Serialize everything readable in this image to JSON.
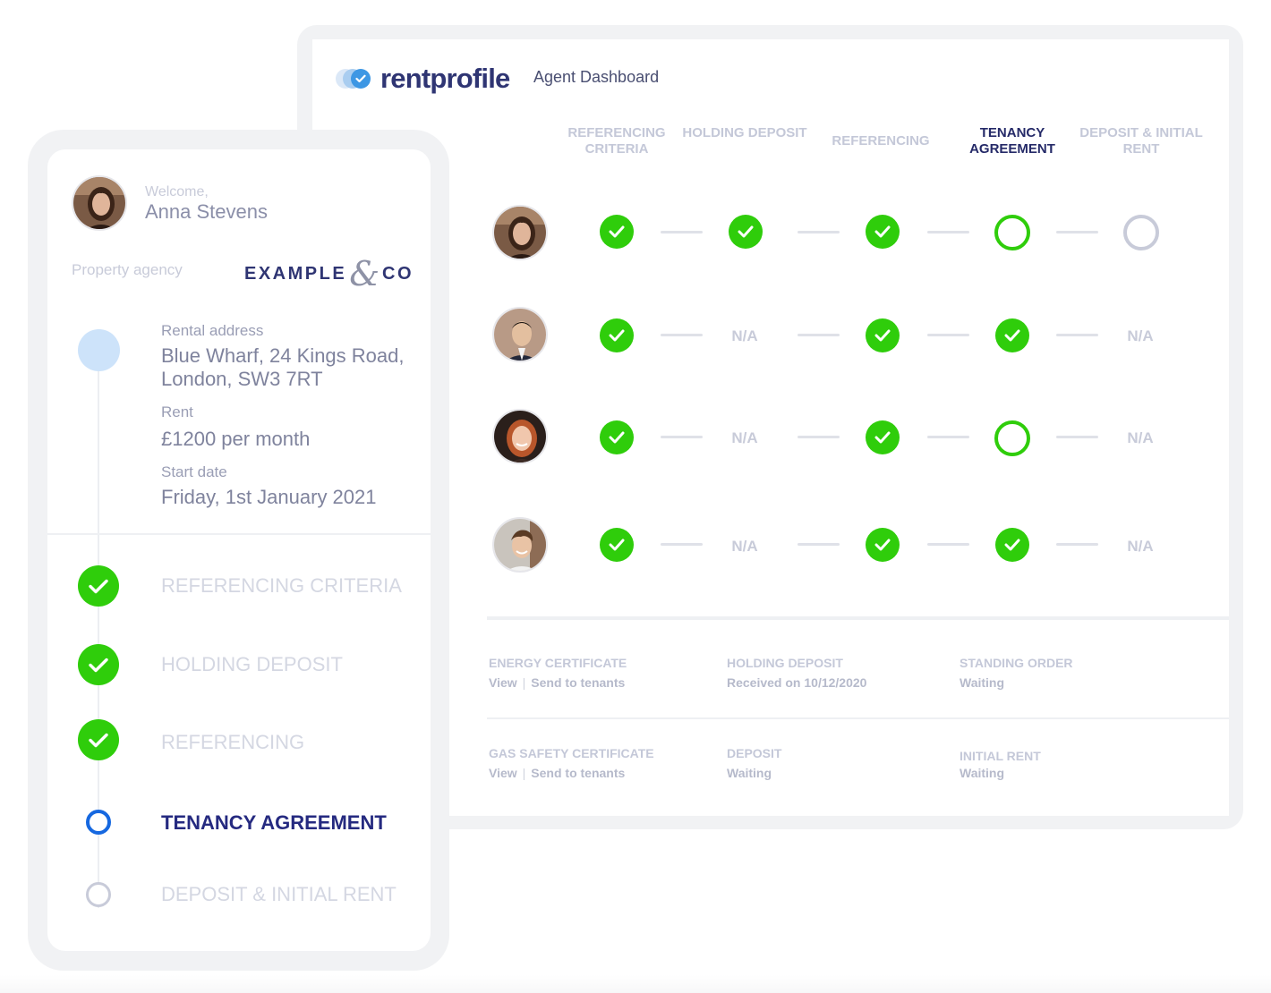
{
  "brand": {
    "name": "rentprofile",
    "subtitle": "Agent Dashboard"
  },
  "columns": [
    "REFERENCING CRITERIA",
    "HOLDING DEPOSIT",
    "REFERENCING",
    "TENANCY AGREEMENT",
    "DEPOSIT & INITIAL RENT"
  ],
  "active_column": "TENANCY AGREEMENT",
  "rows": [
    {
      "tenant": "tenant-1",
      "steps": [
        "done",
        "done",
        "done",
        "in-progress",
        "pending"
      ]
    },
    {
      "tenant": "tenant-2",
      "steps": [
        "done",
        "N/A",
        "done",
        "done",
        "N/A"
      ]
    },
    {
      "tenant": "tenant-3",
      "steps": [
        "done",
        "N/A",
        "done",
        "in-progress",
        "N/A"
      ]
    },
    {
      "tenant": "tenant-4",
      "steps": [
        "done",
        "N/A",
        "done",
        "done",
        "N/A"
      ]
    }
  ],
  "na_label": "N/A",
  "documents": {
    "energy_certificate": {
      "label": "ENERGY CERTIFICATE",
      "view": "View",
      "send": "Send to tenants"
    },
    "holding_deposit": {
      "label": "HOLDING DEPOSIT",
      "value": "Received on 10/12/2020"
    },
    "standing_order": {
      "label": "STANDING ORDER",
      "value": "Waiting"
    },
    "gas_safety_certificate": {
      "label": "GAS SAFETY CERTIFICATE",
      "view": "View",
      "send": "Send to tenants"
    },
    "deposit": {
      "label": "DEPOSIT",
      "value": "Waiting"
    },
    "initial_rent": {
      "label": "INITIAL RENT",
      "value": "Waiting"
    }
  },
  "card": {
    "welcome": "Welcome,",
    "user_name": "Anna Stevens",
    "agency_label": "Property agency",
    "agency_brand_left": "EXAMPLE",
    "agency_brand_amp": "&",
    "agency_brand_right": "CO",
    "rental_address_label": "Rental address",
    "rental_address_line1": "Blue Wharf, 24 Kings Road,",
    "rental_address_line2": "London, SW3 7RT",
    "rent_label": "Rent",
    "rent_value": "£1200 per month",
    "start_date_label": "Start date",
    "start_date_value": "Friday, 1st January 2021",
    "steps": [
      {
        "label": "REFERENCING CRITERIA",
        "status": "done"
      },
      {
        "label": "HOLDING DEPOSIT",
        "status": "done"
      },
      {
        "label": "REFERENCING",
        "status": "done"
      },
      {
        "label": "TENANCY AGREEMENT",
        "status": "in-progress"
      },
      {
        "label": "DEPOSIT & INITIAL RENT",
        "status": "pending"
      }
    ]
  },
  "colors": {
    "green": "#2fcd0b",
    "navy": "#252a68",
    "blue": "#1668e0",
    "muted": "#c8cbd9"
  }
}
